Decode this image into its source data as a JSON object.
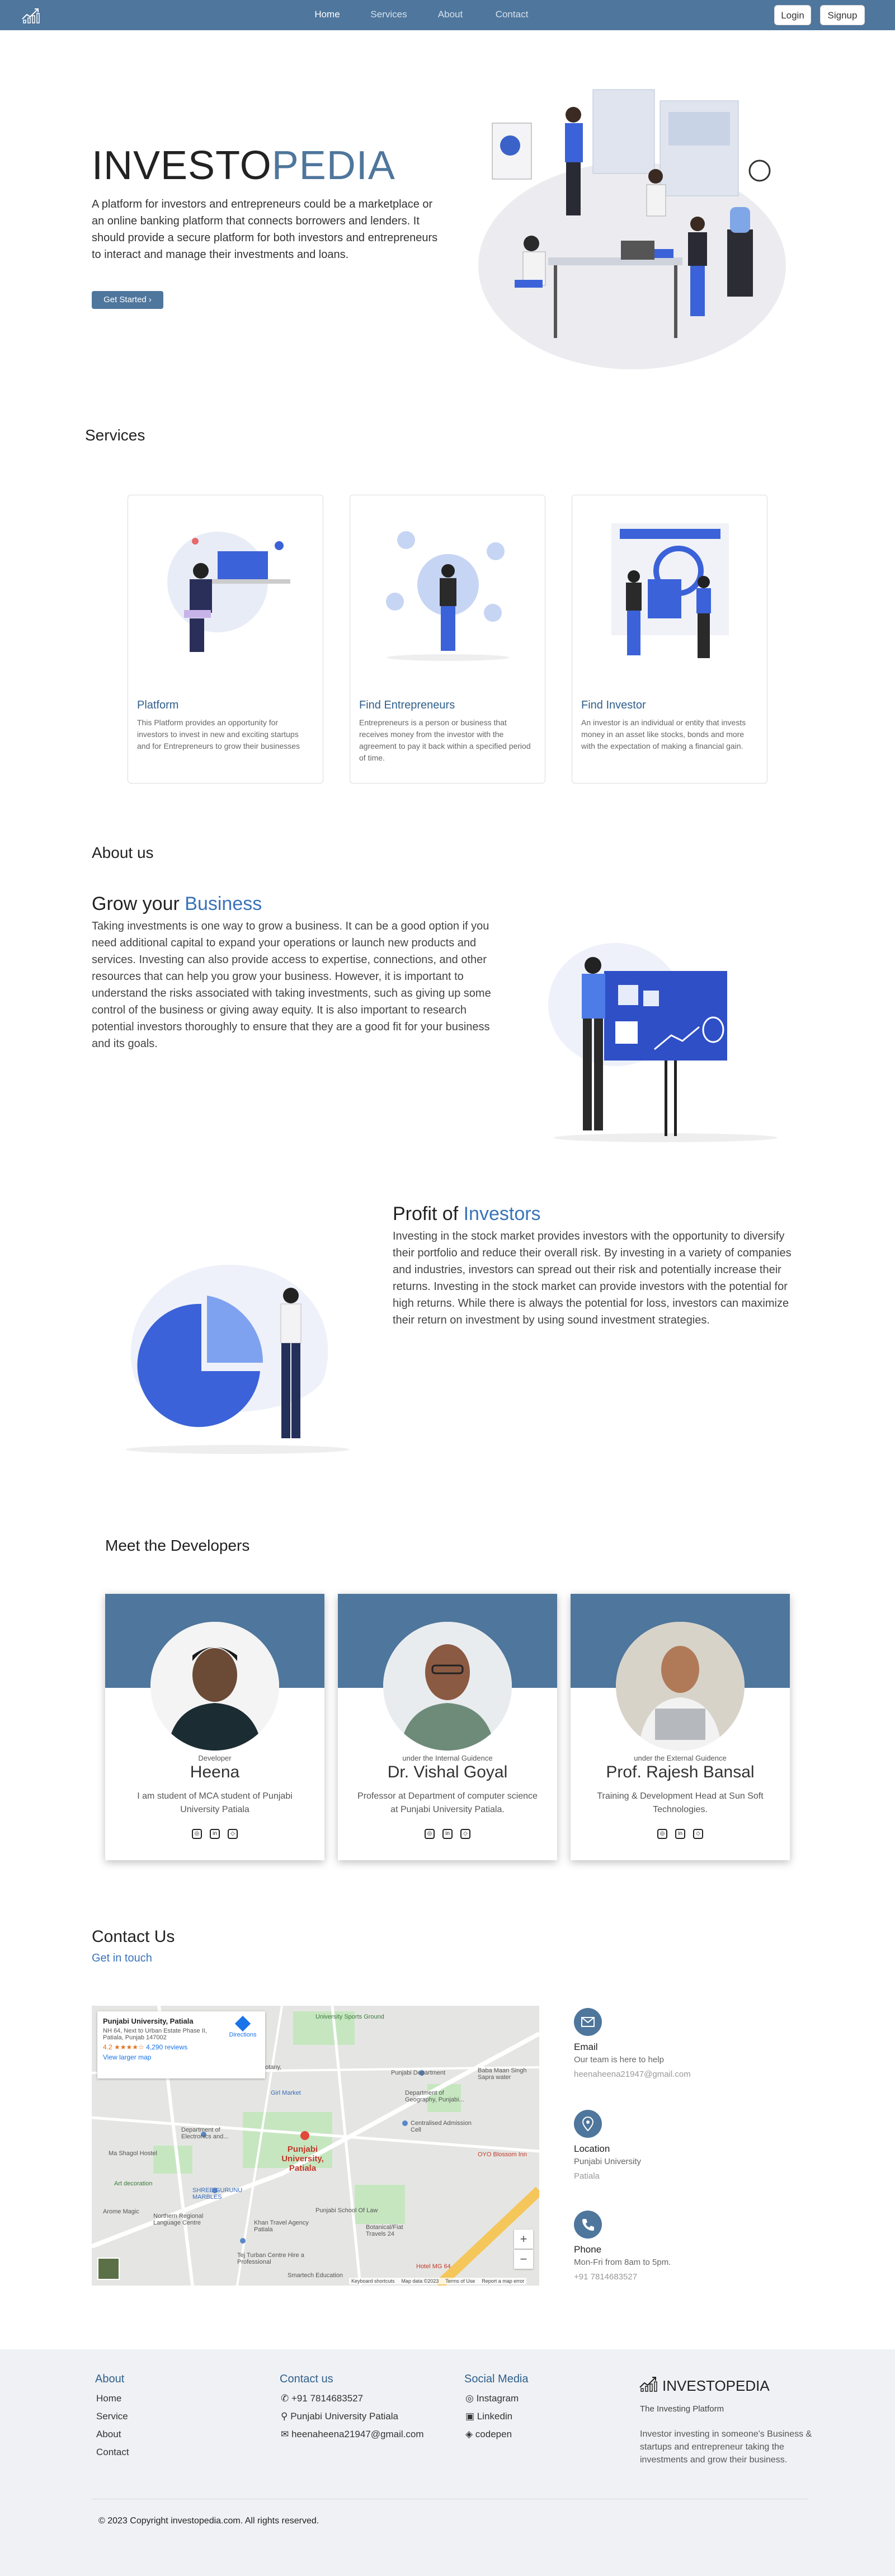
{
  "nav": {
    "links": [
      "Home",
      "Services",
      "About",
      "Contact"
    ],
    "login": "Login",
    "signup": "Signup"
  },
  "hero": {
    "title_main": "INVESTO",
    "title_accent": "PEDIA",
    "description": "A platform for investors and entrepreneurs could be a marketplace or an online banking platform that connects borrowers and lenders. It should provide a secure platform for both investors and entrepreneurs to interact and manage their investments and loans.",
    "cta": "Get Started ›"
  },
  "services": {
    "title": "Services",
    "cards": [
      {
        "title": "Platform",
        "text": "This Platform provides an opportunity for investors to invest in new and exciting startups and for Entrepreneurs to grow their businesses"
      },
      {
        "title": "Find Entrepreneurs",
        "text": "Entrepreneurs is a person or business that receives money from the investor with the agreement to pay it back within a specified period of time."
      },
      {
        "title": "Find Investor",
        "text": "An investor is an individual or entity that invests money in an asset like stocks, bonds and more with the expectation of making a financial gain."
      }
    ]
  },
  "about": {
    "title": "About us",
    "grow_main": "Grow your ",
    "grow_accent": "Business",
    "grow_text": "Taking investments is one way to grow a business. It can be a good option if you need additional capital to expand your operations or launch new products and services. Investing can also provide access to expertise, connections, and other resources that can help you grow your business. However, it is important to understand the risks associated with taking investments, such as giving up some control of the business or giving away equity. It is also important to research potential investors thoroughly to ensure that they are a good fit for your business and its goals.",
    "profit_main": "Profit of ",
    "profit_accent": "Investors",
    "profit_text": "Investing in the stock market provides investors with the opportunity to diversify their portfolio and reduce their overall risk. By investing in a variety of companies and industries, investors can spread out their risk and potentially increase their returns. Investing in the stock market can provide investors with the potential for high returns. While there is always the potential for loss, investors can maximize their return on investment by using sound investment strategies."
  },
  "developers": {
    "title": "Meet the Developers",
    "people": [
      {
        "role": "Developer",
        "name": "Heena",
        "desc": "I am student of MCA student of Punjabi University Patiala"
      },
      {
        "role": "under the Internal Guidence",
        "name": "Dr. Vishal Goyal",
        "desc": "Professor at Department of computer science at Punjabi University Patiala."
      },
      {
        "role": "under the External Guidence",
        "name": "Prof. Rajesh Bansal",
        "desc": "Training & Development Head at Sun Soft Technologies."
      }
    ]
  },
  "contact": {
    "title": "Contact Us",
    "subtitle": "Get in touch",
    "map": {
      "place": "Punjabi University, Patiala",
      "address": "NH 64, Next to Urban Estate Phase II, Patiala, Punjab 147002",
      "rating": "4.2 ★★★★☆",
      "reviews": "4,290 reviews",
      "directions": "Directions",
      "larger": "View larger map",
      "label_main": "Punjabi University, Patiala",
      "labels": [
        "University Sports Ground",
        "Department of Botany, Punjabi...",
        "Punjabi Department",
        "Department of Geography, Punjabi...",
        "Girl Market",
        "Department of Electronics and...",
        "Centralised Admission Cell",
        "Ma Shagol Hostel",
        "Art decoration",
        "SHREE GURUNU MARBLES",
        "Northern Regional Language Centre",
        "Khan Travel Agency Patiala",
        "Punjabi School Of Law",
        "Botanical/Fiat Travels 24",
        "OYO Blossom Inn",
        "Baba Maan Singh Sapra water",
        "Hotel MG 64",
        "Tej Turban Centre Hire a Professional",
        "Smartech Education",
        "Arome Magic"
      ],
      "footer": [
        "Keyboard shortcuts",
        "Map data ©2023",
        "Terms of Use",
        "Report a map error"
      ]
    },
    "items": [
      {
        "head": "Email",
        "sub": "Our team is here to help",
        "val": "heenaheena21947@gmail.com"
      },
      {
        "head": "Location",
        "sub": "Punjabi University",
        "val": "Patiala"
      },
      {
        "head": "Phone",
        "sub": "Mon-Fri from 8am to 5pm.",
        "val": "+91 7814683527"
      }
    ]
  },
  "footer": {
    "about_title": "About",
    "about_items": [
      "Home",
      "Service",
      "About",
      "Contact"
    ],
    "contact_title": "Contact us",
    "contact_items": [
      "+91 7814683527",
      "Punjabi University Patiala",
      "heenaheena21947@gmail.com"
    ],
    "social_title": "Social Media",
    "social_items": [
      "Instagram",
      "Linkedin",
      "codepen"
    ],
    "brand": "INVESTOPEDIA",
    "tagline": "The Investing Platform",
    "brand_text": "Investor investing in someone's Business & startups and entrepreneur taking the investments and grow their business.",
    "copyright": "© 2023 Copyright investopedia.com. All rights reserved."
  },
  "colors": {
    "brand": "#4f769c",
    "accent": "#3a73b8",
    "footer_bg": "#f0f1f4"
  }
}
